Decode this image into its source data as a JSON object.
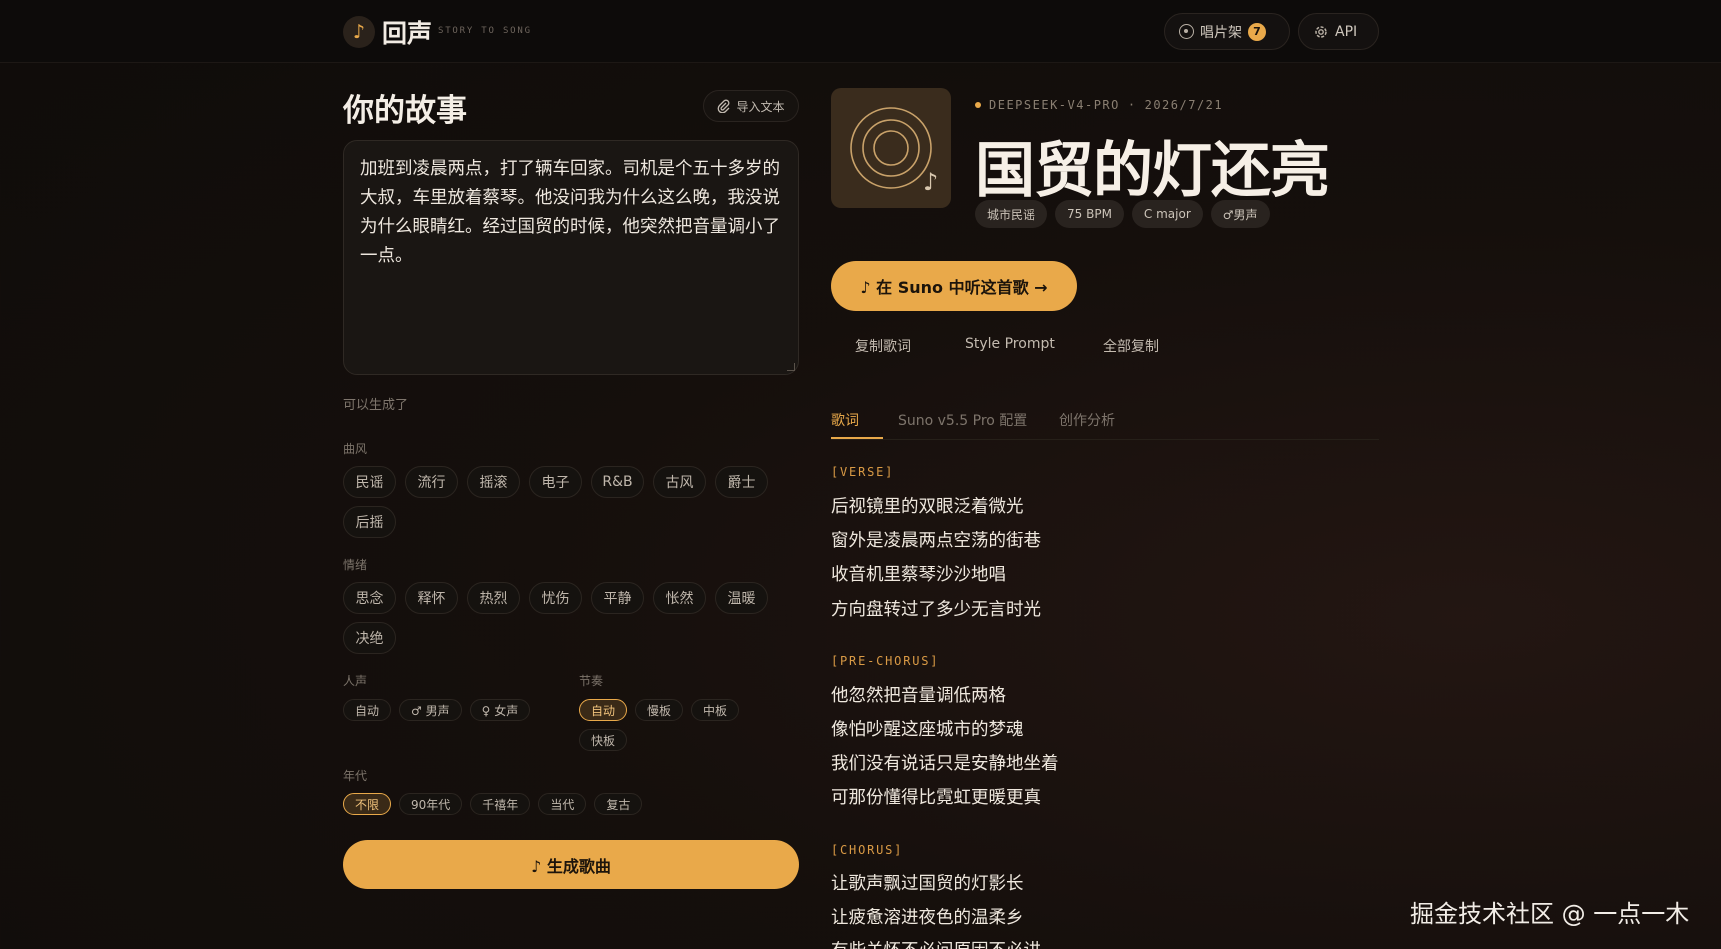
{
  "header": {
    "logo_glyph": "♪",
    "brand": "回声",
    "brand_sub": "STORY TO SONG",
    "shelf_label": "唱片架",
    "shelf_count": "7",
    "api_label": "API"
  },
  "story": {
    "title": "你的故事",
    "import_label": "导入文本",
    "text": "加班到凌晨两点，打了辆车回家。司机是个五十多岁的大叔，车里放着蔡琴。他没问我为什么这么晚，我没说为什么眼睛红。经过国贸的时候，他突然把音量调小了一点。",
    "status": "可以生成了"
  },
  "options": {
    "genre_label": "曲风",
    "genres": [
      "民谣",
      "流行",
      "摇滚",
      "电子",
      "R&B",
      "古风",
      "爵士",
      "后摇"
    ],
    "mood_label": "情绪",
    "moods": [
      "思念",
      "释怀",
      "热烈",
      "忧伤",
      "平静",
      "怅然",
      "温暖",
      "决绝"
    ],
    "vocal_label": "人声",
    "vocals": [
      "自动",
      "♂ 男声",
      "♀ 女声"
    ],
    "tempo_label": "节奏",
    "tempos": [
      "自动",
      "慢板",
      "中板",
      "快板"
    ],
    "tempo_selected": "自动",
    "era_label": "年代",
    "eras": [
      "不限",
      "90年代",
      "千禧年",
      "当代",
      "复古"
    ],
    "era_selected": "不限",
    "generate_label": "♪ 生成歌曲"
  },
  "song": {
    "meta_model": "DEEPSEEK-V4-PRO",
    "meta_sep": "·",
    "meta_date": "2026/7/21",
    "title": "国贸的灯还亮",
    "cover_note": "♪",
    "tags": [
      "城市民谣",
      "75 BPM",
      "C major",
      "♂男声"
    ],
    "suno_label": "♪ 在 Suno 中听这首歌 →",
    "copy_lyrics": "复制歌词",
    "style_prompt": "Style Prompt",
    "copy_all": "全部复制",
    "tabs": [
      "歌词",
      "Suno v5.5 Pro 配置",
      "创作分析"
    ],
    "sections": [
      {
        "tag": "[VERSE]",
        "lines": [
          "后视镜里的双眼泛着微光",
          "窗外是凌晨两点空荡的街巷",
          "收音机里蔡琴沙沙地唱",
          "方向盘转过了多少无言时光"
        ]
      },
      {
        "tag": "[PRE-CHORUS]",
        "lines": [
          "他忽然把音量调低两格",
          "像怕吵醒这座城市的梦魂",
          "我们没有说话只是安静地坐着",
          "可那份懂得比霓虹更暖更真"
        ]
      },
      {
        "tag": "[CHORUS]",
        "lines": [
          "让歌声飘过国贸的灯影长",
          "让疲惫溶进夜色的温柔乡",
          "有些关怀不必问原因不必讲"
        ]
      }
    ]
  },
  "watermark": "掘金技术社区 @ 一点一木",
  "colors": {
    "accent": "#e9a94a",
    "background": "#0f0c0a"
  }
}
